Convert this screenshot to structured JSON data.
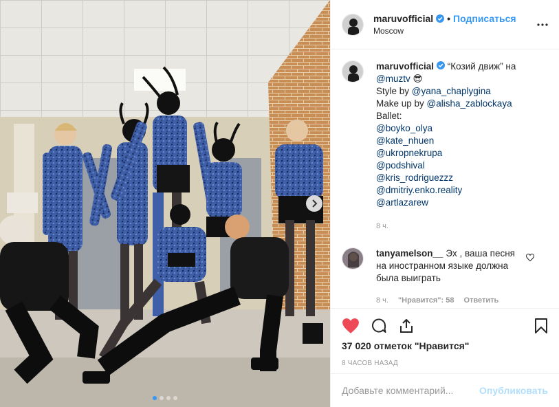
{
  "post": {
    "image_alt": "group of dancers in blue leopard costumes and goat masks",
    "carousel_dots": 4,
    "active_dot": 0
  },
  "header": {
    "username": "maruvofficial",
    "separator": "•",
    "follow_label": "Подписаться",
    "location": "Moscow"
  },
  "caption": {
    "username": "maruvofficial",
    "lines": [
      [
        {
          "t": "text",
          "v": "“Козий движ” на"
        }
      ],
      [
        {
          "t": "mention",
          "v": "@muztv"
        },
        {
          "t": "text",
          "v": " 😎"
        }
      ],
      [
        {
          "t": "text",
          "v": "Style by "
        },
        {
          "t": "mention",
          "v": "@yana_chaplygina"
        }
      ],
      [
        {
          "t": "text",
          "v": "Make up by "
        },
        {
          "t": "mention",
          "v": "@alisha_zablockaya"
        }
      ],
      [
        {
          "t": "text",
          "v": "Ballet:"
        }
      ],
      [
        {
          "t": "mention",
          "v": "@boyko_olya"
        }
      ],
      [
        {
          "t": "mention",
          "v": "@kate_nhuen"
        }
      ],
      [
        {
          "t": "mention",
          "v": "@ukropnekrupa"
        }
      ],
      [
        {
          "t": "mention",
          "v": "@podshival"
        }
      ],
      [
        {
          "t": "mention",
          "v": "@kris_rodriguezzz"
        }
      ],
      [
        {
          "t": "mention",
          "v": "@dmitriy.enko.reality"
        }
      ],
      [
        {
          "t": "mention",
          "v": "@artlazarew"
        }
      ]
    ],
    "time": "8 ч."
  },
  "comment": {
    "username": "tanyamelson__",
    "text": "Эх , ваша песня на иностранном языке должна была выиграть",
    "time": "8 ч.",
    "likes": "\"Нравится\": 58",
    "reply_label": "Ответить"
  },
  "actions": {
    "like_icon": "heart-filled-icon",
    "comment_icon": "comment-icon",
    "share_icon": "share-icon",
    "save_icon": "bookmark-icon",
    "like_color": "#ed4956"
  },
  "likes_text": "37 020 отметок \"Нравится\"",
  "posted_ago": "8 ЧАСОВ НАЗАД",
  "add_comment": {
    "placeholder": "Добавьте комментарий...",
    "publish_label": "Опубликовать"
  },
  "colors": {
    "link": "#3897f0",
    "mention": "#003569",
    "muted": "#999999",
    "publish_disabled": "#b2dffc"
  }
}
